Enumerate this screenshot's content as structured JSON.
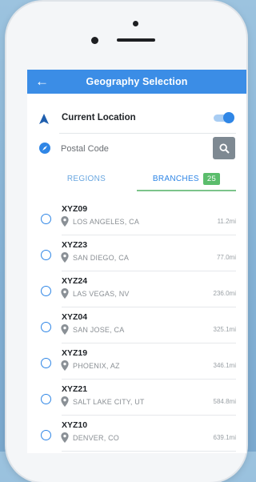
{
  "app_bar": {
    "title": "Geography Selection",
    "back_icon": "arrow-left-icon"
  },
  "current_location": {
    "label": "Current Location",
    "enabled": true,
    "accent": "#2f86e6"
  },
  "postal": {
    "placeholder": "Postal Code",
    "value": ""
  },
  "tabs": {
    "regions": "REGIONS",
    "branches": "BRANCHES",
    "branches_count": "25"
  },
  "branches": [
    {
      "code": "XYZ09",
      "city": "LOS ANGELES, CA",
      "distance": "11.2mi"
    },
    {
      "code": "XYZ23",
      "city": "SAN DIEGO, CA",
      "distance": "77.0mi"
    },
    {
      "code": "XYZ24",
      "city": "LAS VEGAS, NV",
      "distance": "236.0mi"
    },
    {
      "code": "XYZ04",
      "city": "SAN JOSE, CA",
      "distance": "325.1mi"
    },
    {
      "code": "XYZ19",
      "city": "PHOENIX, AZ",
      "distance": "346.1mi"
    },
    {
      "code": "XYZ21",
      "city": "SALT LAKE CITY, UT",
      "distance": "584.8mi"
    },
    {
      "code": "XYZ10",
      "city": "DENVER, CO",
      "distance": "639.1mi"
    }
  ]
}
